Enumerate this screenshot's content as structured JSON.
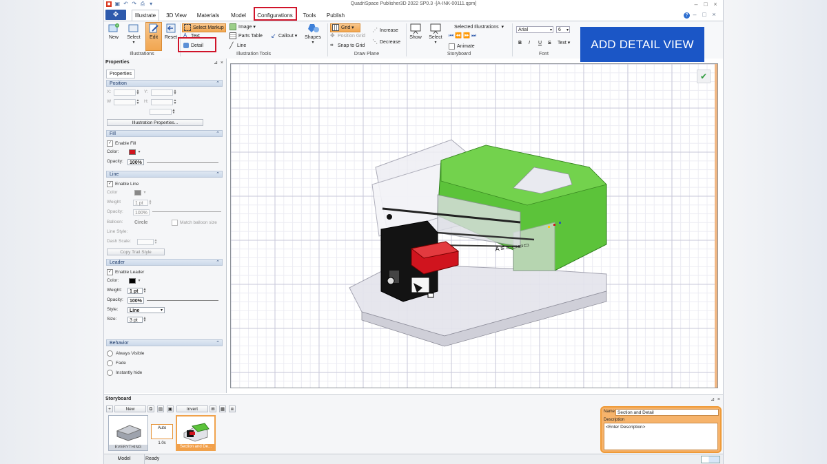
{
  "window": {
    "title": "QuadriSpace Publisher3D  2022 SP0.3 -[A-INK-00111.qpm]"
  },
  "tabs": [
    "Illustrate",
    "3D View",
    "Materials",
    "Model",
    "Configurations",
    "Tools",
    "Publish"
  ],
  "ribbon": {
    "illustrations": {
      "label": "Illustrations",
      "new": "New",
      "select": "Select",
      "edit": "Edit",
      "reset": "Reset"
    },
    "tools": {
      "label": "Illustration Tools",
      "select_markup": "Select Markup",
      "text": "Text",
      "detail": "Detail",
      "image": "Image",
      "parts_table": "Parts Table",
      "line": "Line",
      "callout": "Callout",
      "shapes": "Shapes"
    },
    "draw_plane": {
      "label": "Draw Plane",
      "grid": "Grid",
      "position_grid": "Position Grid",
      "snap_to_grid": "Snap to Grid",
      "increase": "Increase",
      "decrease": "Decrease"
    },
    "storyboard": {
      "label": "Storyboard",
      "show": "Show",
      "select": "Select",
      "selected_illustrations": "Selected Illustrations",
      "animate": "Animate"
    },
    "font": {
      "label": "Font",
      "family": "Arial",
      "size": "6",
      "bold": "B",
      "italic": "I",
      "underline": "U",
      "strike": "S",
      "text": "Text"
    }
  },
  "properties": {
    "title": "Properties",
    "tab": "Properties",
    "position": {
      "header": "Position",
      "x": "X:",
      "y": "Y:",
      "w": "W",
      "h": "H:",
      "illustration_properties": "Illustration Properties..."
    },
    "fill": {
      "header": "Fill",
      "enable": "Enable Fill",
      "color": "Color:",
      "opacity": "Opacity:",
      "opacity_value": "100%",
      "color_hex": "#d0141e"
    },
    "line": {
      "header": "Line",
      "enable": "Enable Line",
      "color": "Color",
      "weight": "Weight",
      "weight_value": "1 pt",
      "opacity": "Opacity:",
      "opacity_value": "100%",
      "balloon": "Balloon:",
      "balloon_value": "Circle",
      "match_balloon": "Match balloon size",
      "line_style": "Line Style:",
      "dash_scale": "Dash Scale:",
      "copy_trail": "Copy Trail Style"
    },
    "leader": {
      "header": "Leader",
      "enable": "Enable Leader",
      "color": "Color:",
      "weight": "Weight:",
      "weight_value": "1 pt",
      "opacity": "Opacity:",
      "opacity_value": "100%",
      "style": "Style:",
      "style_value": "Line",
      "size": "Size:",
      "size_value": "3 pt"
    },
    "behavior": {
      "header": "Behavior",
      "always_visible": "Always Visible",
      "fade": "Fade",
      "instantly_hide": "Instantly hide"
    }
  },
  "overlay": {
    "caption": "ADD DETAIL VIEW"
  },
  "canvas": {
    "model_label": "A  ≡ ▭▭▭▭"
  },
  "storyboard": {
    "title": "Storyboard",
    "new": "New",
    "invert": "Invert",
    "thumbs": [
      "EVERYTHING",
      "Section and De..."
    ],
    "auto": "Auto",
    "time": "1.0s",
    "name_label": "Name",
    "name_value": "Section and Detail",
    "desc_label": "Description",
    "desc_value": "<Enter Description>"
  },
  "status": {
    "tab": "Model",
    "text": "Ready"
  }
}
